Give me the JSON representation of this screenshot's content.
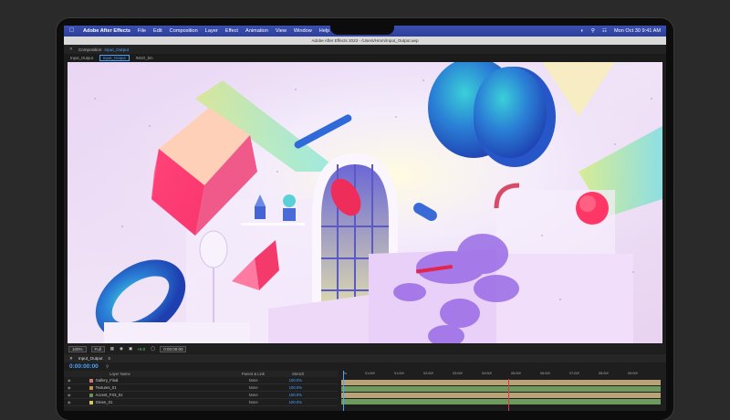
{
  "menubar": {
    "app_name": "Adobe After Effects",
    "items": [
      "File",
      "Edit",
      "Composition",
      "Layer",
      "Effect",
      "Animation",
      "View",
      "Window",
      "Help"
    ],
    "datetime": "Mon Oct 30  9:41 AM"
  },
  "titlebar": {
    "title": "Adobe After Effects 2023 - /Users/Hmm/Input_Output.aep"
  },
  "composition": {
    "prefix": "Composition",
    "name": "Input_Output",
    "breadcrumbs": [
      "Input_Output",
      "Input_Output",
      "INSO_bm"
    ]
  },
  "viewer_toolbar": {
    "zoom": "100%",
    "quality": "Full",
    "offset": "+0.0",
    "timecode": "0:00:00:00"
  },
  "timeline": {
    "tab_label": "Input_Output",
    "timecode": "0:00:00:00",
    "columns": {
      "layer_name": "Layer Name",
      "parent": "Parent & Link",
      "stretch": "Stretch"
    },
    "layers": [
      {
        "name": "Gallery_Final",
        "color": "#c77b7b",
        "parent": "None",
        "stretch": "100.0%"
      },
      {
        "name": "Textures_01",
        "color": "#d08c4a",
        "parent": "None",
        "stretch": "100.0%"
      },
      {
        "name": "Accent_FX3_01",
        "color": "#6a8f5a",
        "parent": "None",
        "stretch": "100.0%"
      },
      {
        "name": "Green_01",
        "color": "#d8c45a",
        "parent": "None",
        "stretch": "100.0%"
      }
    ],
    "ruler_marks": [
      "0s",
      "01:00f",
      "01:00f",
      "02:00f",
      "03:00f",
      "04:00f",
      "05:00f",
      "06:00f",
      "07:00f",
      "08:00f",
      "09:00f"
    ],
    "footer": "Toggle Switches / Modes"
  },
  "colors": {
    "accent_blue": "#4aa3ff",
    "menubar_blue": "#3b4fb0",
    "track_tan": "#b9a27a",
    "track_green": "#6e9a5c"
  }
}
